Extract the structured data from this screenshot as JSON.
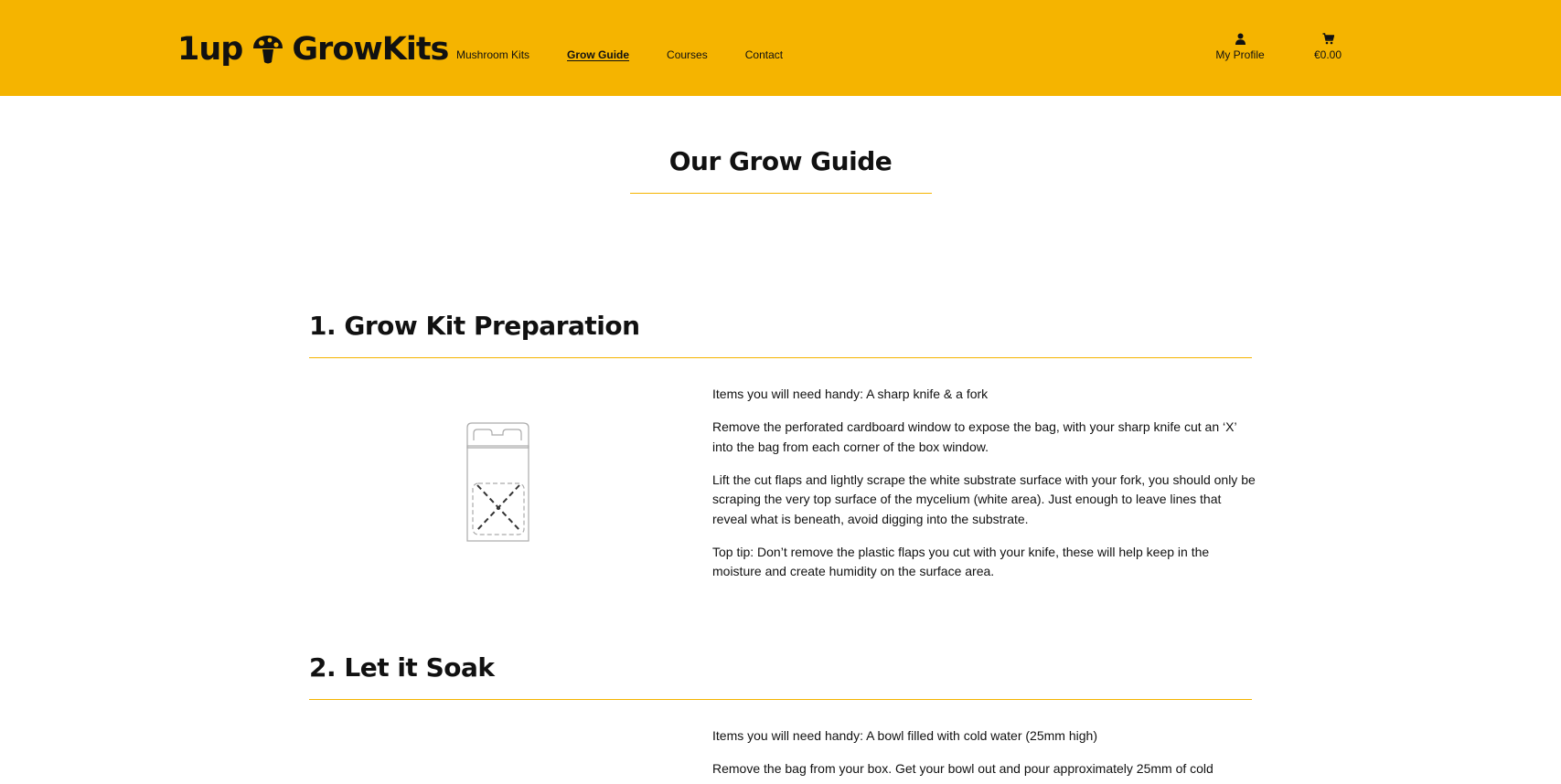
{
  "header": {
    "logo": {
      "part1": "1up",
      "part2": "GrowKits",
      "icon": "mushroom-icon"
    },
    "nav": [
      {
        "label": "Mushroom Kits",
        "active": false
      },
      {
        "label": "Grow Guide",
        "active": true
      },
      {
        "label": "Courses",
        "active": false
      },
      {
        "label": "Contact",
        "active": false
      }
    ],
    "profile": {
      "label": "My Profile",
      "icon": "user-icon"
    },
    "cart": {
      "label": "€0.00",
      "icon": "cart-icon"
    }
  },
  "page": {
    "title": "Our Grow Guide"
  },
  "sections": [
    {
      "heading": "1. Grow Kit Preparation",
      "paragraphs": [
        "Items you will need handy: A sharp knife & a fork",
        "Remove the perforated cardboard window to expose the bag, with your sharp knife cut an ‘X’ into the bag from each corner of the box window.",
        "Lift the cut flaps and lightly scrape the white substrate surface with your fork, you should only be scraping the very top surface of the mycelium (white area). Just enough to leave lines that reveal what is beneath, avoid digging into the substrate.",
        "Top tip: Don’t remove the plastic flaps you cut with your knife, these will help keep in the moisture and create humidity on the surface area."
      ]
    },
    {
      "heading": "2. Let it Soak",
      "paragraphs": [
        "Items you will need handy: A bowl filled with cold water (25mm high)",
        "Remove the bag from your box. Get your bowl out and pour approximately 25mm of cold"
      ]
    }
  ],
  "colors": {
    "brand": "#f5b400",
    "text": "#111111",
    "background": "#ffffff"
  }
}
